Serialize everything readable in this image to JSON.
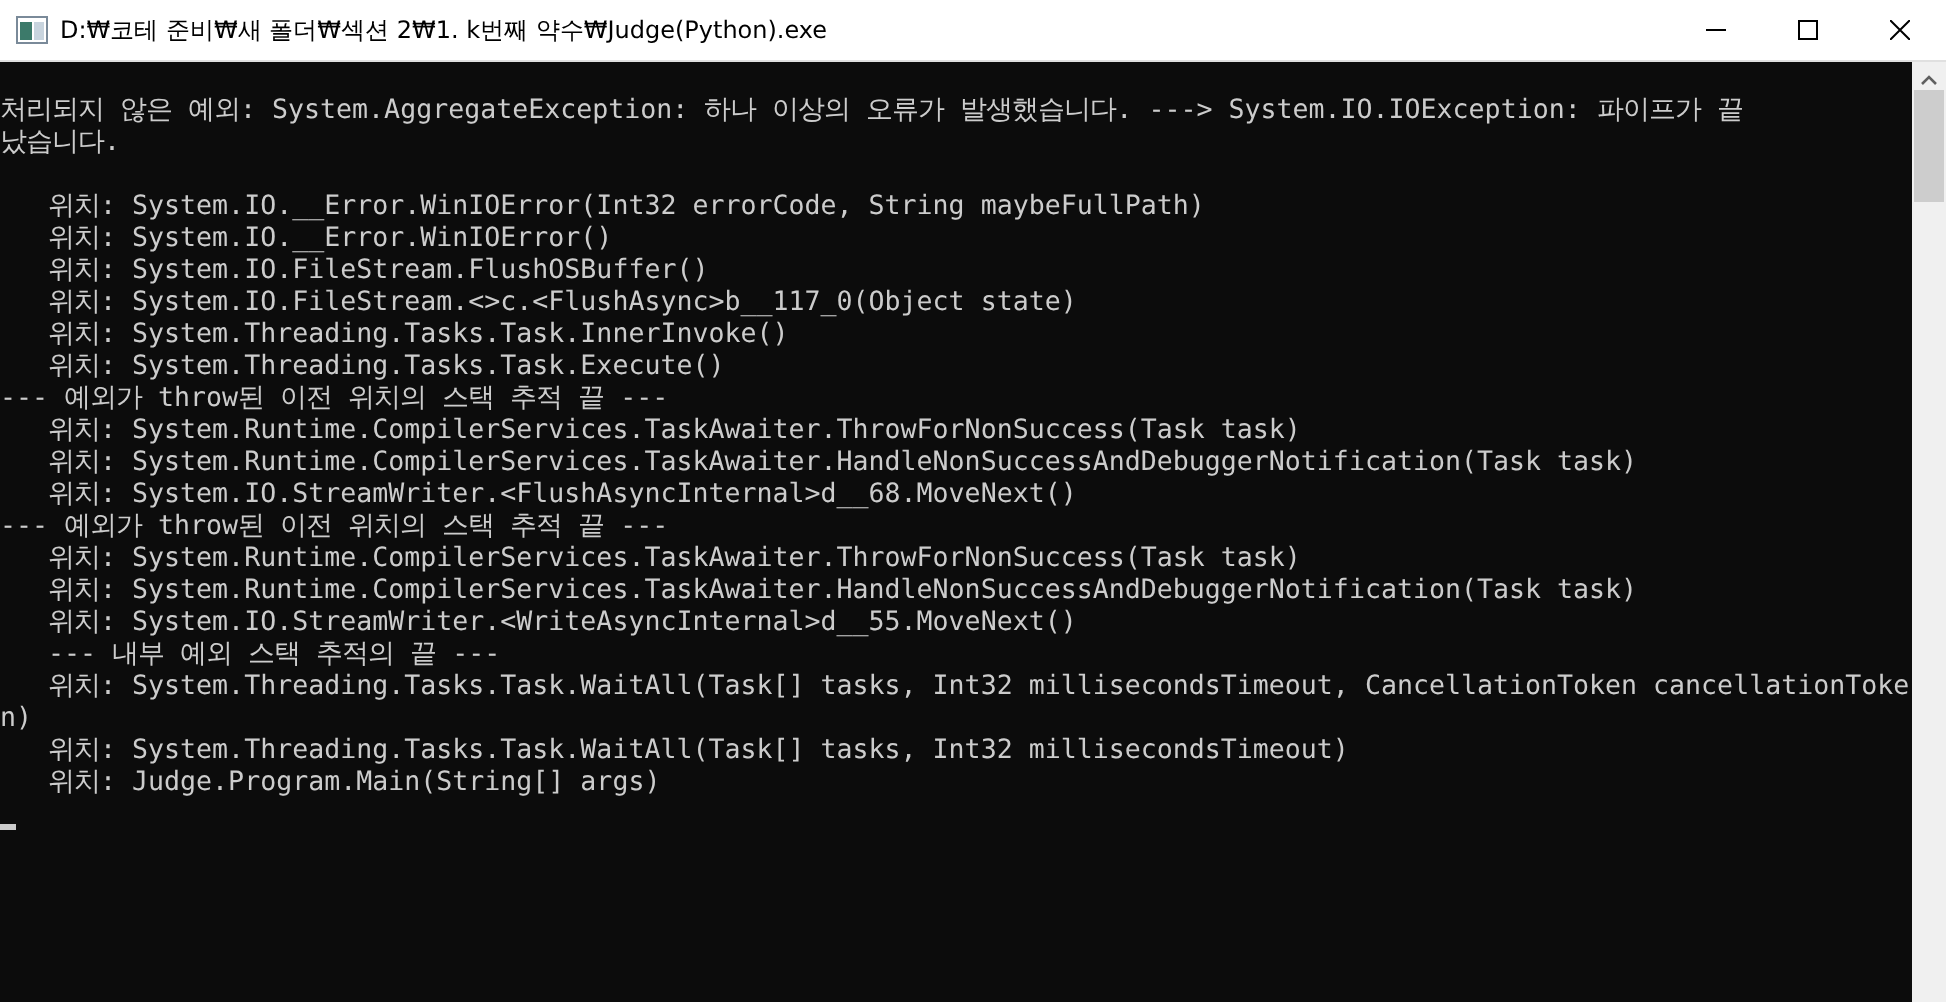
{
  "window": {
    "title": "D:₩코테 준비₩새 폴더₩섹션 2₩1. k번째 약수₩Judge(Python).exe"
  },
  "console": {
    "cursor": true,
    "blocks": [
      {
        "lines": [
          "처리되지 않은 예외: System.AggregateException: 하나 이상의 오류가 발생했습니다. ---> System.IO.IOException: 파이프가 끝",
          "났습니다."
        ]
      },
      {
        "lines": [
          "   위치: System.IO.__Error.WinIOError(Int32 errorCode, String maybeFullPath)",
          "   위치: System.IO.__Error.WinIOError()",
          "   위치: System.IO.FileStream.FlushOSBuffer()",
          "   위치: System.IO.FileStream.<>c.<FlushAsync>b__117_0(Object state)",
          "   위치: System.Threading.Tasks.Task.InnerInvoke()",
          "   위치: System.Threading.Tasks.Task.Execute()",
          "--- 예외가 throw된 이전 위치의 스택 추적 끝 ---",
          "   위치: System.Runtime.CompilerServices.TaskAwaiter.ThrowForNonSuccess(Task task)",
          "   위치: System.Runtime.CompilerServices.TaskAwaiter.HandleNonSuccessAndDebuggerNotification(Task task)",
          "   위치: System.IO.StreamWriter.<FlushAsyncInternal>d__68.MoveNext()",
          "--- 예외가 throw된 이전 위치의 스택 추적 끝 ---",
          "   위치: System.Runtime.CompilerServices.TaskAwaiter.ThrowForNonSuccess(Task task)",
          "   위치: System.Runtime.CompilerServices.TaskAwaiter.HandleNonSuccessAndDebuggerNotification(Task task)",
          "   위치: System.IO.StreamWriter.<WriteAsyncInternal>d__55.MoveNext()",
          "   --- 내부 예외 스택 추적의 끝 ---",
          "   위치: System.Threading.Tasks.Task.WaitAll(Task[] tasks, Int32 millisecondsTimeout, CancellationToken cancellationToke",
          "n)",
          "   위치: System.Threading.Tasks.Task.WaitAll(Task[] tasks, Int32 millisecondsTimeout)",
          "   위치: Judge.Program.Main(String[] args)"
        ]
      }
    ]
  }
}
